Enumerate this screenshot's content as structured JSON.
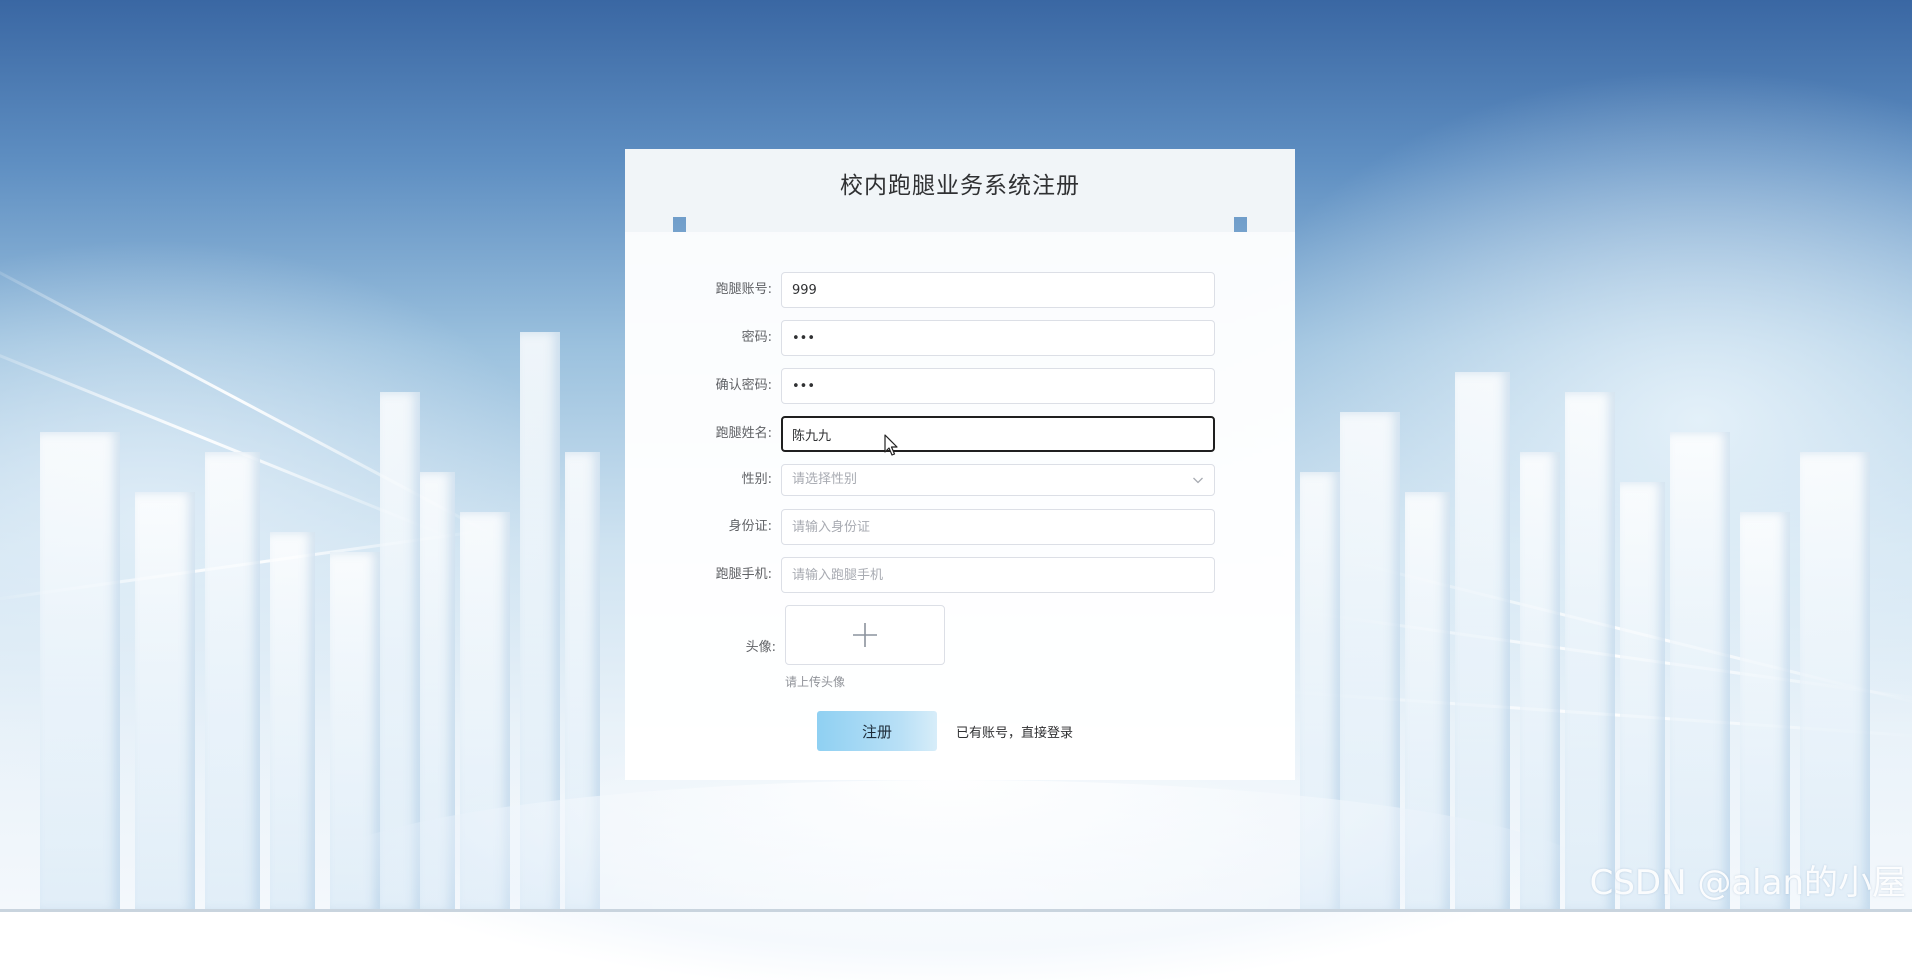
{
  "page": {
    "title": "校内跑腿业务系统注册"
  },
  "form": {
    "account": {
      "label": "跑腿账号:",
      "value": "999"
    },
    "password": {
      "label": "密码:",
      "value": "•••"
    },
    "confirm_password": {
      "label": "确认密码:",
      "value": "•••"
    },
    "name": {
      "label": "跑腿姓名:",
      "value": "陈九九"
    },
    "gender": {
      "label": "性别:",
      "placeholder": "请选择性别"
    },
    "id_card": {
      "label": "身份证:",
      "placeholder": "请输入身份证"
    },
    "phone": {
      "label": "跑腿手机:",
      "placeholder": "请输入跑腿手机"
    },
    "avatar": {
      "label": "头像:",
      "hint": "请上传头像"
    }
  },
  "actions": {
    "register_label": "注册",
    "login_link": "已有账号，直接登录"
  },
  "watermark": "CSDN @alan的小屋",
  "colors": {
    "button_gradient_start": "#8fd0f2",
    "button_gradient_end": "#d7edf9",
    "focus_border": "#1f1f1f",
    "placeholder": "#a8abb2"
  },
  "icons": {
    "upload": "plus-icon",
    "select": "chevron-down-icon",
    "cursor": "mouse-cursor-icon"
  }
}
